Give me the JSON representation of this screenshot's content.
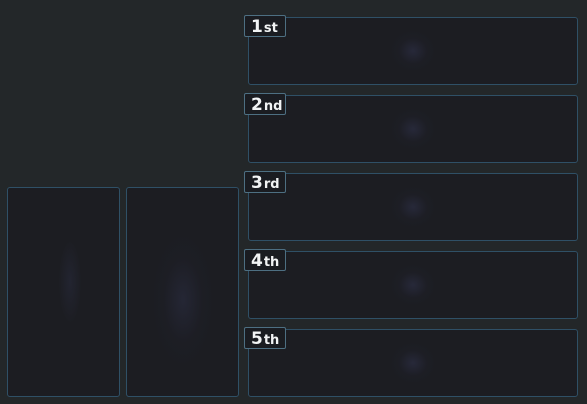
{
  "ranking": {
    "slots": [
      {
        "number": "1",
        "suffix": "st"
      },
      {
        "number": "2",
        "suffix": "nd"
      },
      {
        "number": "3",
        "suffix": "rd"
      },
      {
        "number": "4",
        "suffix": "th"
      },
      {
        "number": "5",
        "suffix": "th"
      }
    ]
  },
  "colors": {
    "background": "#232729",
    "panel": "#1c1d22",
    "panel_border": "#2f5066",
    "tag_border": "#4d6f82",
    "tag_text": "#f2f4f5"
  }
}
